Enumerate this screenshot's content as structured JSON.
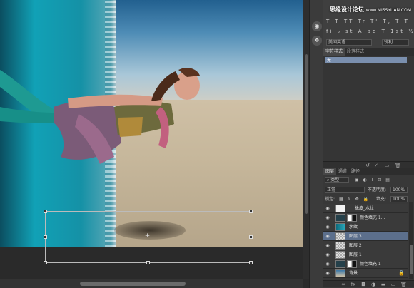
{
  "watermark": {
    "brand": "思缘设计论坛",
    "url": "www.MISSYUAN.COM"
  },
  "character_panel": {
    "type_buttons_row1": "T T TT Tr T' T, T T",
    "type_buttons_row2": "fi ℴ st A ad T 1st ½",
    "language": "美国英语",
    "antialias": "锐利"
  },
  "styles_panel": {
    "tabs": [
      "字符样式",
      "段落样式"
    ],
    "active_tab": 0,
    "selected_style": "无"
  },
  "layers_panel": {
    "tabs": [
      "图层",
      "通道",
      "路径"
    ],
    "active_tab": 0,
    "kind_filter": "类型",
    "blend_mode": "正常",
    "opacity_label": "不透明度:",
    "opacity_value": "100%",
    "lock_label": "锁定:",
    "fill_label": "填充:",
    "fill_value": "100%",
    "layers": [
      {
        "name": "橡皮_水纹",
        "thumb": "white",
        "selected": false,
        "mask": false,
        "locked": false
      },
      {
        "name": "颜色填充 1...",
        "thumb": "dark",
        "selected": false,
        "mask": true,
        "locked": false
      },
      {
        "name": "水纹",
        "thumb": "teal",
        "selected": false,
        "mask": false,
        "locked": false
      },
      {
        "name": "图层 3",
        "thumb": "checker",
        "selected": true,
        "mask": false,
        "locked": false
      },
      {
        "name": "图层 2",
        "thumb": "checker",
        "selected": false,
        "mask": false,
        "locked": false
      },
      {
        "name": "图层 1",
        "thumb": "checker",
        "selected": false,
        "mask": false,
        "locked": false
      },
      {
        "name": "颜色填充 1",
        "thumb": "dark",
        "selected": false,
        "mask": true,
        "locked": false
      },
      {
        "name": "背景",
        "thumb": "bg",
        "selected": false,
        "mask": false,
        "locked": true
      }
    ]
  },
  "colors": {
    "panel_bg": "#3a3a3a",
    "selection": "#5c6f8c",
    "style_selected": "#7a8fae"
  }
}
